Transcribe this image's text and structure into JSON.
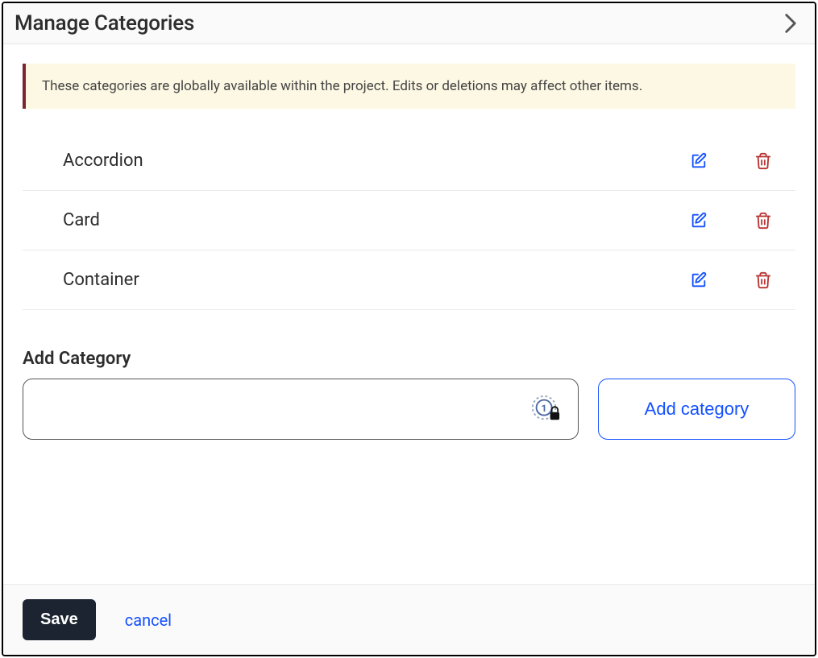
{
  "header": {
    "title": "Manage Categories"
  },
  "alert": {
    "message": "These categories are globally available within the project. Edits or deletions may affect other items."
  },
  "categories": [
    {
      "name": "Accordion"
    },
    {
      "name": "Card"
    },
    {
      "name": "Container"
    }
  ],
  "add_section": {
    "label": "Add Category",
    "input_value": "",
    "input_placeholder": "",
    "button_label": "Add category"
  },
  "footer": {
    "save_label": "Save",
    "cancel_label": "cancel"
  },
  "icons": {
    "chevron_right": "chevron-right-icon",
    "edit": "pencil-icon",
    "delete": "trash-icon",
    "lock": "lock-icon"
  },
  "colors": {
    "edit_icon": "#1450ff",
    "delete_icon": "#b83232",
    "alert_bg": "#fdf8e3",
    "alert_border": "#7a2530",
    "primary_button_bg": "#1b2430",
    "outline_button_border": "#1450ff"
  }
}
